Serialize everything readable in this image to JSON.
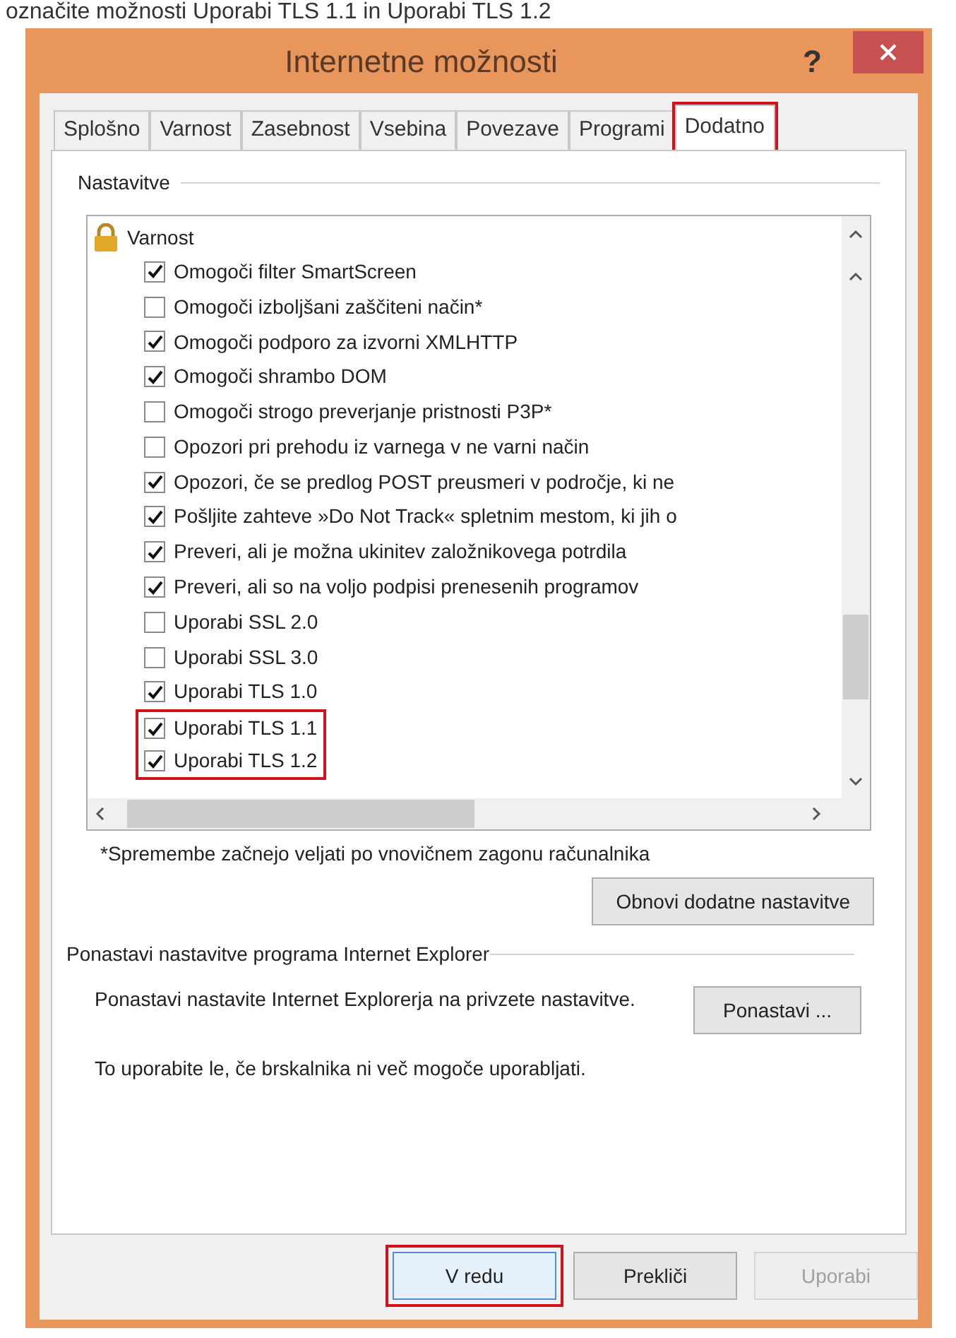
{
  "caption": "označite možnosti Uporabi TLS 1.1 in Uporabi TLS 1.2",
  "window": {
    "title": "Internetne možnosti",
    "help": "?"
  },
  "tabs": [
    {
      "label": "Splošno",
      "selected": false,
      "highlighted": false
    },
    {
      "label": "Varnost",
      "selected": false,
      "highlighted": false
    },
    {
      "label": "Zasebnost",
      "selected": false,
      "highlighted": false
    },
    {
      "label": "Vsebina",
      "selected": false,
      "highlighted": false
    },
    {
      "label": "Povezave",
      "selected": false,
      "highlighted": false
    },
    {
      "label": "Programi",
      "selected": false,
      "highlighted": false
    },
    {
      "label": "Dodatno",
      "selected": true,
      "highlighted": true
    }
  ],
  "settings": {
    "legend": "Nastavitve",
    "group": "Varnost",
    "items": [
      {
        "label": "Omogoči filter SmartScreen",
        "checked": true,
        "highlighted": false
      },
      {
        "label": "Omogoči izboljšani zaščiteni način*",
        "checked": false,
        "highlighted": false
      },
      {
        "label": "Omogoči podporo za izvorni XMLHTTP",
        "checked": true,
        "highlighted": false
      },
      {
        "label": "Omogoči shrambo DOM",
        "checked": true,
        "highlighted": false
      },
      {
        "label": "Omogoči strogo preverjanje pristnosti P3P*",
        "checked": false,
        "highlighted": false
      },
      {
        "label": "Opozori pri prehodu iz varnega v ne varni način",
        "checked": false,
        "highlighted": false
      },
      {
        "label": "Opozori, če se predlog POST preusmeri v področje, ki ne",
        "checked": true,
        "highlighted": false
      },
      {
        "label": "Pošljite zahteve »Do Not Track« spletnim mestom, ki jih o",
        "checked": true,
        "highlighted": false
      },
      {
        "label": "Preveri, ali je možna ukinitev založnikovega potrdila",
        "checked": true,
        "highlighted": false
      },
      {
        "label": "Preveri, ali so na voljo podpisi prenesenih programov",
        "checked": true,
        "highlighted": false
      },
      {
        "label": "Uporabi SSL 2.0",
        "checked": false,
        "highlighted": false
      },
      {
        "label": "Uporabi SSL 3.0",
        "checked": false,
        "highlighted": false
      },
      {
        "label": "Uporabi TLS 1.0",
        "checked": true,
        "highlighted": false
      },
      {
        "label": "Uporabi TLS 1.1",
        "checked": true,
        "highlighted": true
      },
      {
        "label": "Uporabi TLS 1.2",
        "checked": true,
        "highlighted": true
      }
    ],
    "note": "*Spremembe začnejo veljati po vnovičnem zagonu računalnika",
    "restore_button": "Obnovi dodatne nastavitve"
  },
  "reset": {
    "legend": "Ponastavi nastavitve programa Internet Explorer",
    "text": "Ponastavi nastavite Internet Explorerja na privzete nastavitve.",
    "button": "Ponastavi ...",
    "hint": "To uporabite le, če brskalnika ni več mogoče uporabljati."
  },
  "buttons": [
    {
      "label": "V redu",
      "disabled": false,
      "highlighted": true
    },
    {
      "label": "Prekliči",
      "disabled": false,
      "highlighted": false
    },
    {
      "label": "Uporabi",
      "disabled": true,
      "highlighted": false
    }
  ]
}
